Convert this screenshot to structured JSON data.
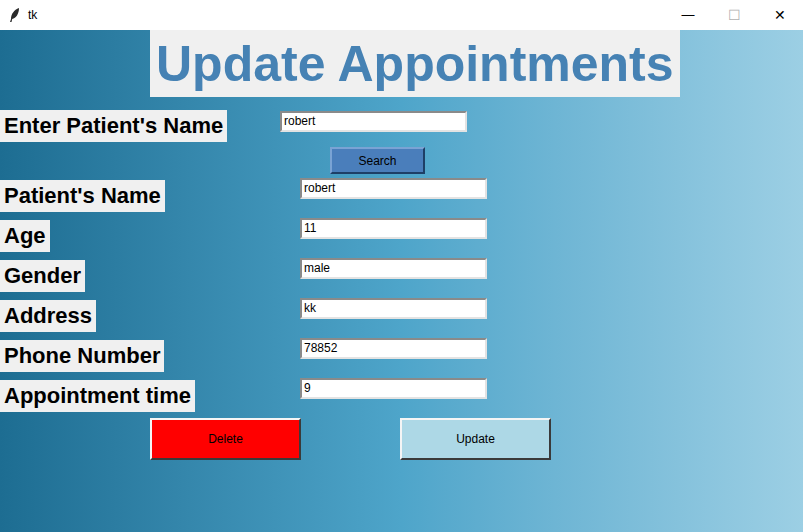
{
  "window": {
    "title": "tk",
    "controls": {
      "minimize": "—",
      "maximize": "☐",
      "close": "✕"
    }
  },
  "heading": "Update Appointments",
  "search": {
    "label": "Enter Patient's Name",
    "value": "robert",
    "button": "Search"
  },
  "fields": [
    {
      "label": "Patient's Name",
      "value": "robert"
    },
    {
      "label": "Age",
      "value": "11"
    },
    {
      "label": "Gender",
      "value": "male"
    },
    {
      "label": "Address",
      "value": "kk"
    },
    {
      "label": "Phone Number",
      "value": "78852"
    },
    {
      "label": "Appointment time",
      "value": "9"
    }
  ],
  "buttons": [
    {
      "label": "Delete",
      "color": "#ff0000"
    },
    {
      "label": "Update",
      "color": "#add8e6"
    }
  ]
}
